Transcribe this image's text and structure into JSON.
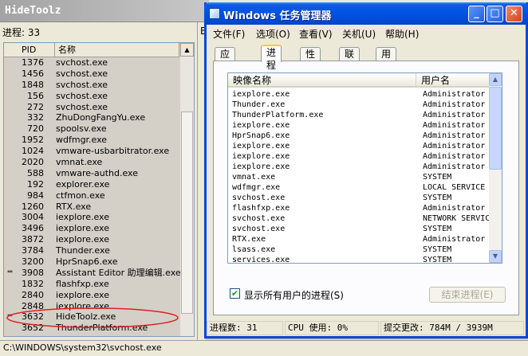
{
  "hidetoolz": {
    "title": "HideToolz",
    "process_count_label": "进程:",
    "process_count": "33",
    "columns": {
      "pid": "PID",
      "name": "名称"
    },
    "rows": [
      {
        "mark": "",
        "pid": "1376",
        "name": "svchost.exe"
      },
      {
        "mark": "",
        "pid": "1456",
        "name": "svchost.exe"
      },
      {
        "mark": "",
        "pid": "1848",
        "name": "svchost.exe"
      },
      {
        "mark": "",
        "pid": "156",
        "name": "svchost.exe"
      },
      {
        "mark": "",
        "pid": "272",
        "name": "svchost.exe"
      },
      {
        "mark": "",
        "pid": "332",
        "name": "ZhuDongFangYu.exe"
      },
      {
        "mark": "",
        "pid": "720",
        "name": "spoolsv.exe"
      },
      {
        "mark": "",
        "pid": "1952",
        "name": "wdfmgr.exe"
      },
      {
        "mark": "",
        "pid": "1024",
        "name": "vmware-usbarbitrator.exe"
      },
      {
        "mark": "",
        "pid": "2020",
        "name": "vmnat.exe"
      },
      {
        "mark": "",
        "pid": "588",
        "name": "vmware-authd.exe"
      },
      {
        "mark": "",
        "pid": "192",
        "name": "explorer.exe"
      },
      {
        "mark": "",
        "pid": "984",
        "name": "ctfmon.exe"
      },
      {
        "mark": "",
        "pid": "1260",
        "name": "RTX.exe"
      },
      {
        "mark": "",
        "pid": "3004",
        "name": "iexplore.exe"
      },
      {
        "mark": "",
        "pid": "3496",
        "name": "iexplore.exe"
      },
      {
        "mark": "",
        "pid": "3872",
        "name": "iexplore.exe"
      },
      {
        "mark": "",
        "pid": "3784",
        "name": "Thunder.exe"
      },
      {
        "mark": "",
        "pid": "3200",
        "name": "HprSnap6.exe"
      },
      {
        "mark": "**",
        "pid": "3908",
        "name": "Assistant Editor 助理编辑.exe"
      },
      {
        "mark": "",
        "pid": "1832",
        "name": "flashfxp.exe"
      },
      {
        "mark": "",
        "pid": "2840",
        "name": "iexplore.exe"
      },
      {
        "mark": "",
        "pid": "2848",
        "name": "iexplore.exe"
      },
      {
        "mark": "**",
        "pid": "3632",
        "name": "HideToolz.exe"
      },
      {
        "mark": "",
        "pid": "3652",
        "name": "ThunderPlatform.exe"
      }
    ],
    "right_panel_stub": "B",
    "status_path": "C:\\WINDOWS\\system32\\svchost.exe"
  },
  "taskmgr": {
    "title": "Windows 任务管理器",
    "caption_buttons": {
      "minimize": "_",
      "maximize": "□",
      "close": "✕"
    },
    "menus": [
      "文件(F)",
      "选项(O)",
      "查看(V)",
      "关机(U)",
      "帮助(H)"
    ],
    "tabs": [
      "应用程序",
      "进程",
      "性能",
      "联网",
      "用户"
    ],
    "active_tab": 1,
    "columns": {
      "image": "映像名称",
      "user": "用户名"
    },
    "rows": [
      {
        "image": "iexplore.exe",
        "user": "Administrator"
      },
      {
        "image": "Thunder.exe",
        "user": "Administrator"
      },
      {
        "image": "ThunderPlatform.exe",
        "user": "Administrator"
      },
      {
        "image": "iexplore.exe",
        "user": "Administrator"
      },
      {
        "image": "HprSnap6.exe",
        "user": "Administrator"
      },
      {
        "image": "iexplore.exe",
        "user": "Administrator"
      },
      {
        "image": "iexplore.exe",
        "user": "Administrator"
      },
      {
        "image": "iexplore.exe",
        "user": "Administrator"
      },
      {
        "image": "vmnat.exe",
        "user": "SYSTEM"
      },
      {
        "image": "wdfmgr.exe",
        "user": "LOCAL SERVICE"
      },
      {
        "image": "svchost.exe",
        "user": "SYSTEM"
      },
      {
        "image": "flashfxp.exe",
        "user": "Administrator"
      },
      {
        "image": "svchost.exe",
        "user": "NETWORK SERVICE"
      },
      {
        "image": "svchost.exe",
        "user": "SYSTEM"
      },
      {
        "image": "RTX.exe",
        "user": "Administrator"
      },
      {
        "image": "lsass.exe",
        "user": "SYSTEM"
      },
      {
        "image": "services.exe",
        "user": "SYSTEM"
      }
    ],
    "show_all_users_checked": true,
    "show_all_users_check": "✔",
    "show_all_users_label": "显示所有用户的进程(S)",
    "end_process_label": "结束进程(E)",
    "status": {
      "processes": "进程数: 31",
      "cpu": "CPU 使用: 0%",
      "commit": "提交更改: 784M / 3939M"
    }
  },
  "colors": {
    "xp_title_blue": "#0053e0",
    "annotation_red": "#e02020"
  }
}
